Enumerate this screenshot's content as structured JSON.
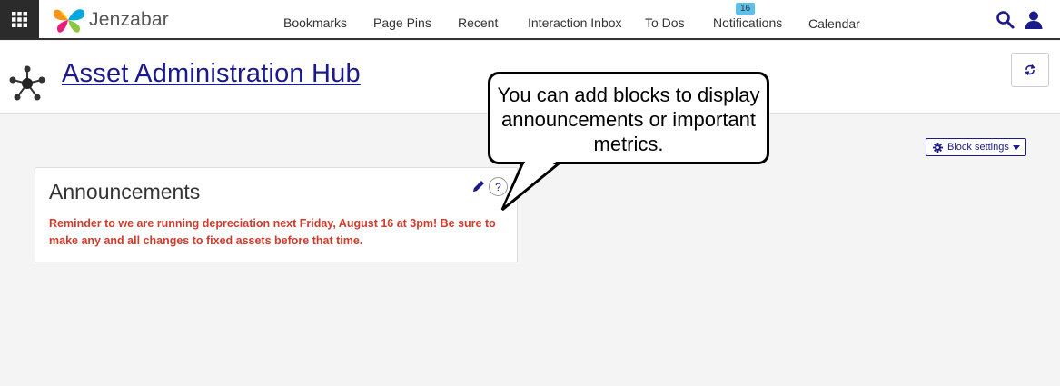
{
  "topbar": {
    "logo_text": "Jenzabar",
    "nav": [
      {
        "label": "Bookmarks"
      },
      {
        "label": "Page Pins"
      },
      {
        "label": "Recent"
      },
      {
        "label": "Interaction Inbox"
      },
      {
        "label": "To Dos"
      },
      {
        "label": "Notifications"
      },
      {
        "label": "Calendar"
      }
    ],
    "notifications_count": "16"
  },
  "header": {
    "title": "Asset Administration Hub"
  },
  "block_settings": {
    "label": "Block settings"
  },
  "announcements": {
    "title": "Announcements",
    "help_label": "?",
    "text": "Reminder to we are running depreciation next Friday, August 16 at 3pm! Be sure to make any and all changes to fixed assets before that time."
  },
  "callout": {
    "text": "You can add blocks to display announcements or important metrics."
  },
  "colors": {
    "accent": "#1a1a8c",
    "alert": "#d13b2b",
    "badge": "#5bc0eb"
  }
}
